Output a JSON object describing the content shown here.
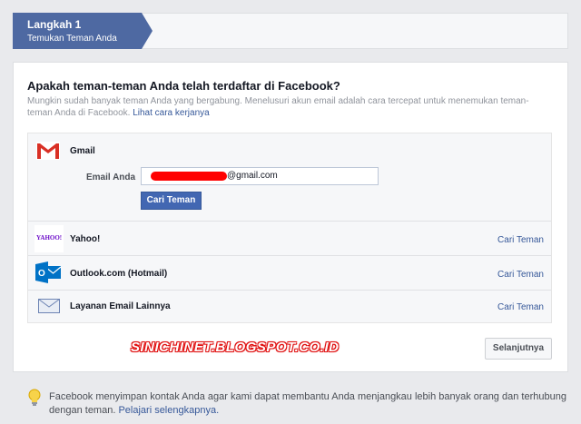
{
  "step": {
    "title": "Langkah 1",
    "subtitle": "Temukan Teman Anda"
  },
  "main": {
    "heading": "Apakah teman-teman Anda telah terdaftar di Facebook?",
    "description": "Mungkin sudah banyak teman Anda yang bergabung. Menelusuri akun email adalah cara tercepat untuk menemukan teman-teman Anda di Facebook.",
    "how_link": "Lihat cara kerjanya"
  },
  "services": {
    "gmail": {
      "name": "Gmail",
      "email_label": "Email Anda",
      "email_value": "@gmail.com",
      "button": "Cari Teman",
      "icon": "gmail-icon"
    },
    "yahoo": {
      "name": "Yahoo!",
      "logo": "YAHOO!",
      "link": "Cari Teman",
      "icon": "yahoo-icon"
    },
    "outlook": {
      "name": "Outlook.com (Hotmail)",
      "link": "Cari Teman",
      "icon": "outlook-icon"
    },
    "other": {
      "name": "Layanan Email Lainnya",
      "link": "Cari Teman",
      "icon": "envelope-icon"
    }
  },
  "next_button": "Selanjutnya",
  "watermark": "SINICHINET.BLOGSPOT.CO.ID",
  "footer": {
    "text": "Facebook menyimpan kontak Anda agar kami dapat membantu Anda menjangkau lebih banyak orang dan terhubung dengan teman.",
    "link": "Pelajari selengkapnya."
  },
  "colors": {
    "brand": "#4e69a2",
    "button": "#4267b2",
    "link": "#365899",
    "redaction": "#ff0000"
  }
}
